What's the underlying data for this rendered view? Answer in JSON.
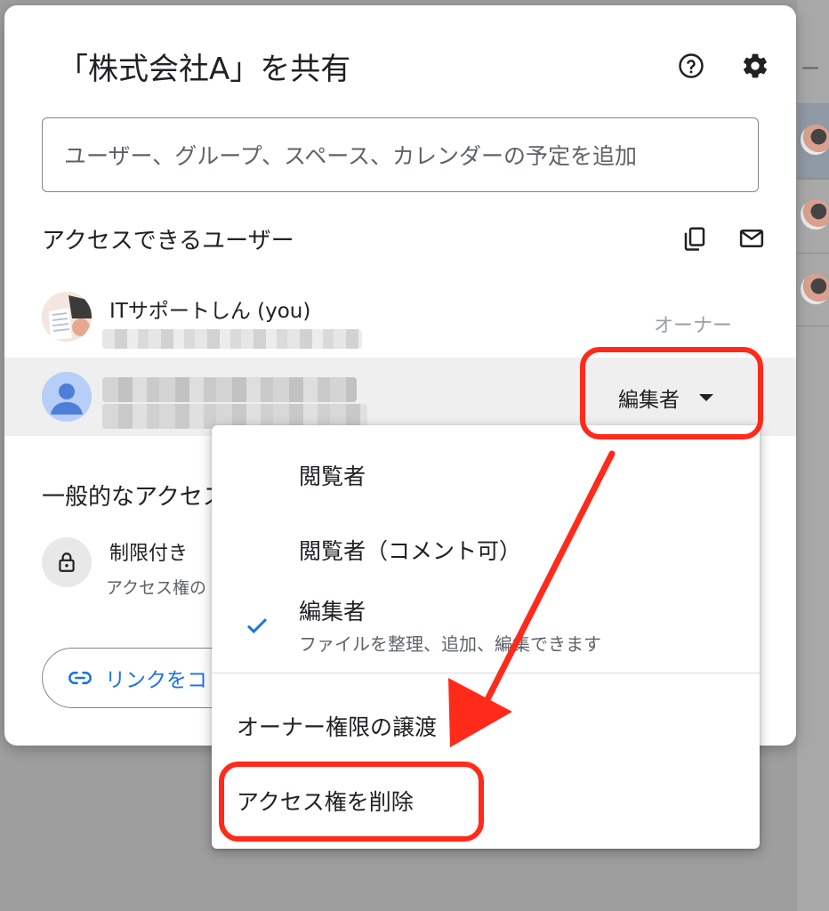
{
  "dialog": {
    "title": "「株式会社A」を共有"
  },
  "search": {
    "placeholder": "ユーザー、グループ、スペース、カレンダーの予定を追加"
  },
  "people": {
    "section_label": "アクセスできるユーザー",
    "owner": {
      "name": "ITサポートしん (you)",
      "role": "オーナー"
    },
    "editor": {
      "role": "編集者"
    }
  },
  "general_access": {
    "label": "一般的なアクセス",
    "mode_title": "制限付き",
    "mode_desc": "アクセス権の"
  },
  "link_button": {
    "label": "リンクをコ"
  },
  "menu": {
    "viewer": "閲覧者",
    "commenter": "閲覧者（コメント可）",
    "editor": "編集者",
    "editor_desc": "ファイルを整理、追加、編集できます",
    "transfer": "オーナー権限の譲渡",
    "remove": "アクセス権を削除"
  },
  "background": {
    "peek_text": "ー"
  },
  "colors": {
    "annotation": "#ff2a1a",
    "accent": "#1a73e8"
  },
  "icons": [
    "help-icon",
    "settings-icon",
    "copy-icon",
    "mail-icon",
    "lock-icon",
    "link-icon",
    "check-icon",
    "person-icon",
    "caret-down-icon"
  ]
}
